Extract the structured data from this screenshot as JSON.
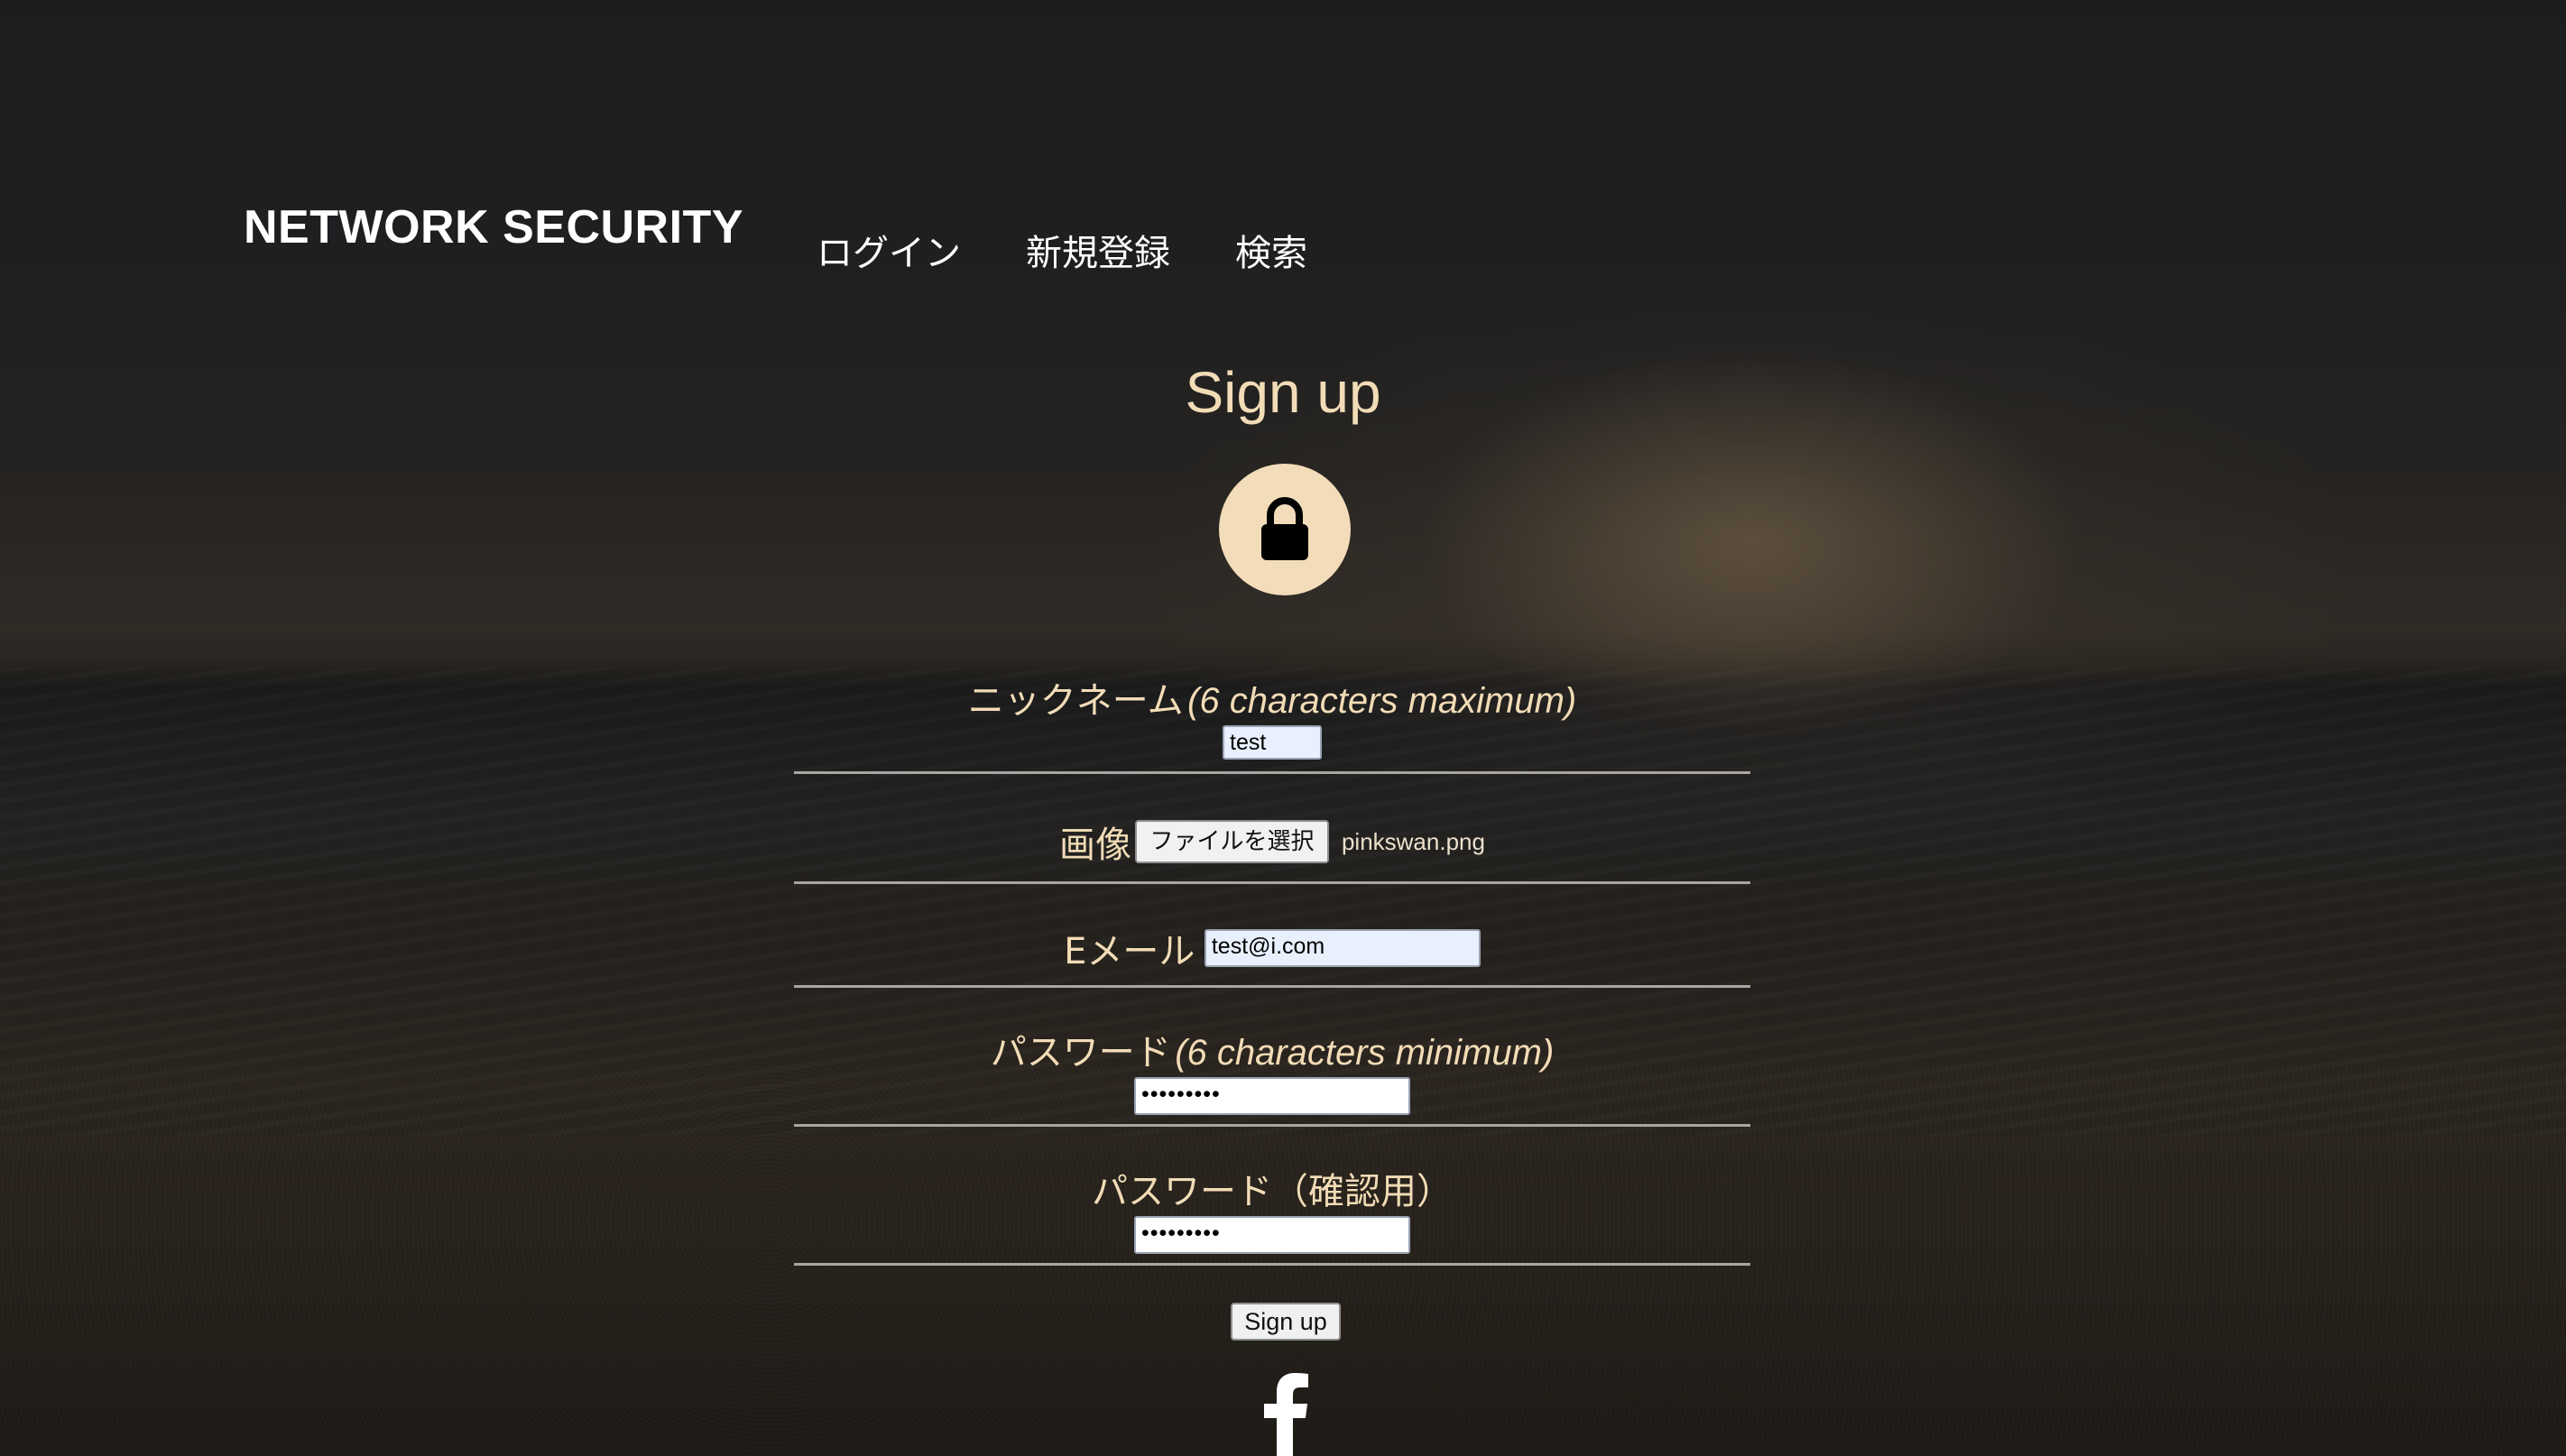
{
  "header": {
    "brand": "NETWORK SECURITY",
    "nav": [
      {
        "label": "ログイン"
      },
      {
        "label": "新規登録"
      },
      {
        "label": "検索"
      }
    ]
  },
  "form": {
    "title": "Sign up",
    "lock_icon": "lock-icon",
    "nickname": {
      "label": "ニックネーム",
      "hint": "(6 characters maximum)",
      "value": "test"
    },
    "image": {
      "label": "画像",
      "button_label": "ファイルを選択",
      "file_name": "pinkswan.png"
    },
    "email": {
      "label": "Eメール",
      "value": "test@i.com"
    },
    "password": {
      "label": "パスワード",
      "hint": "(6 characters minimum)",
      "value": "•••••••••"
    },
    "password_confirm": {
      "label": "パスワード（確認用）",
      "value": "•••••••••"
    },
    "submit_label": "Sign up"
  },
  "footer": {
    "social_icon": "facebook-icon"
  },
  "colors": {
    "accent": "#f2dcb6",
    "lock_circle": "#f3dcb9",
    "separator": "#a9a6a1"
  }
}
